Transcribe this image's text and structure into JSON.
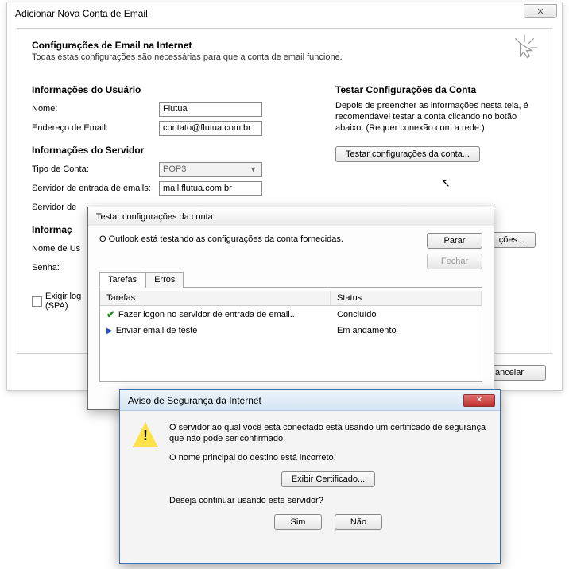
{
  "main": {
    "title": "Adicionar Nova Conta de Email",
    "close_glyph": "✕",
    "heading": "Configurações de Email na Internet",
    "subheading": "Todas estas configurações são necessárias para que a conta de email funcione.",
    "user_section": "Informações do Usuário",
    "name_label": "Nome:",
    "name_value": "Flutua",
    "email_label": "Endereço de Email:",
    "email_value": "contato@flutua.com.br",
    "server_section": "Informações do Servidor",
    "accttype_label": "Tipo de Conta:",
    "accttype_value": "POP3",
    "incoming_label": "Servidor de entrada de emails:",
    "incoming_value": "mail.flutua.com.br",
    "outgoing_label": "Servidor de",
    "login_section": "Informaç",
    "username_label": "Nome de Us",
    "password_label": "Senha:",
    "spa_label": "Exigir log\n(SPA)",
    "right_heading": "Testar Configurações da Conta",
    "right_p1": "Depois de preencher as informações nesta tela, é recomendável testar a conta clicando no botão abaixo. (Requer conexão com a rede.)",
    "test_button": "Testar configurações da conta...",
    "more_button": "ções...",
    "footer_cancel": "ancelar"
  },
  "test": {
    "title": "Testar configurações da conta",
    "msg": "O Outlook está testando as configurações da conta fornecidas.",
    "stop_btn": "Parar",
    "close_btn": "Fechar",
    "tab_tasks": "Tarefas",
    "tab_errors": "Erros",
    "col_tasks": "Tarefas",
    "col_status": "Status",
    "rows": [
      {
        "icon": "check",
        "task": "Fazer logon no servidor de entrada de email...",
        "status": "Concluído"
      },
      {
        "icon": "arrow",
        "task": "Enviar email de teste",
        "status": "Em andamento"
      }
    ]
  },
  "warn": {
    "title": "Aviso de Segurança da Internet",
    "close_glyph": "✕",
    "p1": "O servidor ao qual você está conectado está usando um certificado de segurança que não pode ser confirmado.",
    "p2": "O nome principal do destino está incorreto.",
    "cert_btn": "Exibir Certificado...",
    "p3": "Deseja continuar usando este servidor?",
    "yes": "Sim",
    "no": "Não"
  }
}
